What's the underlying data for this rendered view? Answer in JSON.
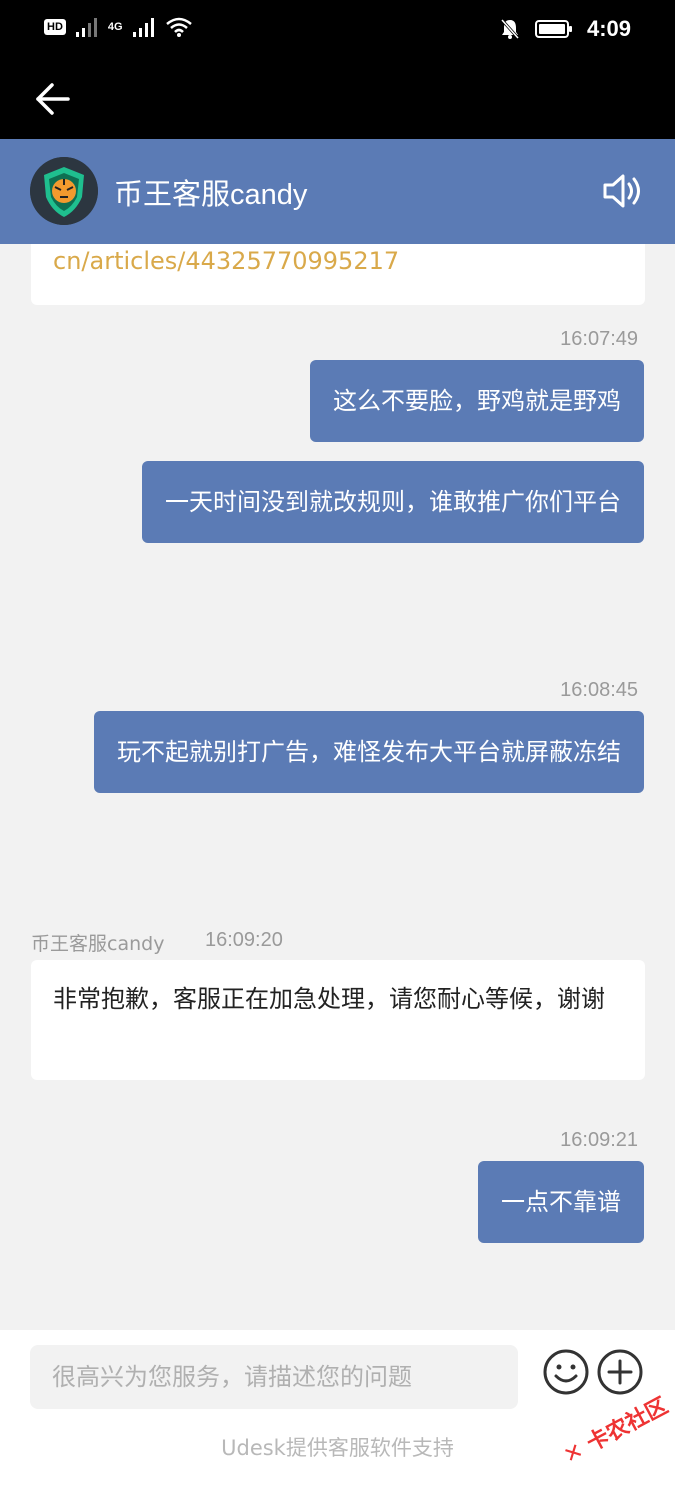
{
  "status_bar": {
    "badge": "HD",
    "network": "4G",
    "time": "4:09"
  },
  "header": {
    "title": "币王客服candy"
  },
  "messages": {
    "m0_link_tail": "cn/articles/44325770995217",
    "t1": "16:07:49",
    "m1": "这么不要脸，野鸡就是野鸡",
    "m2": "一天时间没到就改规则，谁敢推广你们平台",
    "t2": "16:08:45",
    "m3": "玩不起就别打广告，难怪发布大平台就屏蔽冻结",
    "agent_name": "币王客服candy",
    "t3": "16:09:20",
    "m4": "非常抱歉，客服正在加急处理，请您耐心等候，谢谢",
    "t4": "16:09:21",
    "m5": "一点不靠谱"
  },
  "input": {
    "placeholder": "很高兴为您服务，请描述您的问题"
  },
  "footer": {
    "support_text": "Udesk提供客服软件支持"
  },
  "watermark": "卡农社区",
  "colors": {
    "header_bg": "#5b7bb5",
    "outgoing_bubble": "#5b7bb5",
    "link": "#d9a94a",
    "chat_bg": "#f2f2f2"
  }
}
